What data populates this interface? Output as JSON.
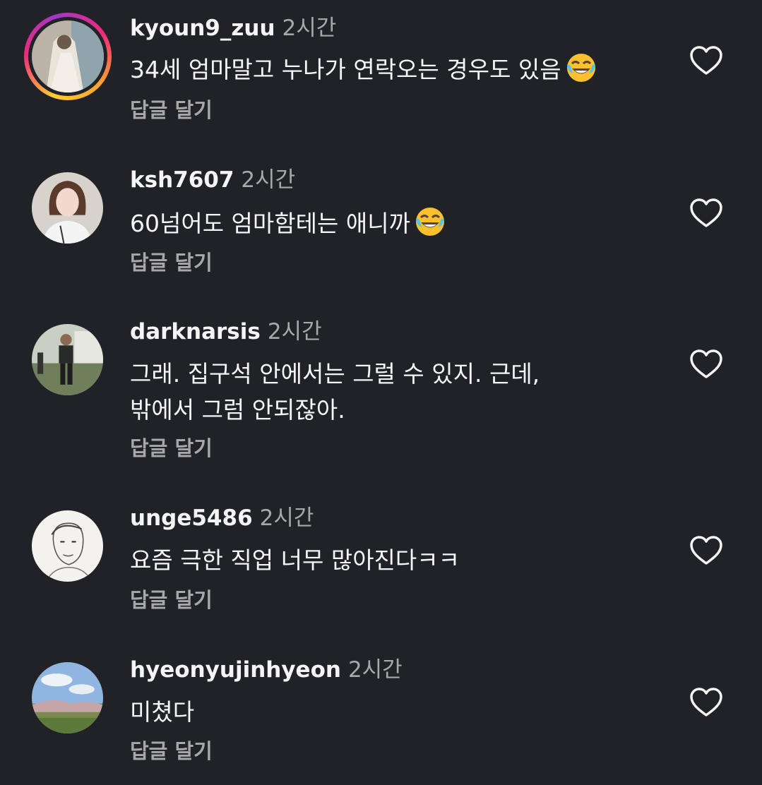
{
  "comments": [
    {
      "username": "kyoun9_zuu",
      "time": "2시간",
      "text_before_emoji": "34세 엄마말고 누나가 연락오는 경우도 있음",
      "text_line2": "",
      "emoji": "face-with-tears-of-joy-icon",
      "reply_label": "답글 달기",
      "has_story_ring": true
    },
    {
      "username": "ksh7607",
      "time": "2시간",
      "text_before_emoji": "60넘어도 엄마함테는 애니까",
      "text_line2": "",
      "emoji": "face-with-tears-of-joy-icon",
      "reply_label": "답글 달기",
      "has_story_ring": false
    },
    {
      "username": "darknarsis",
      "time": "2시간",
      "text_before_emoji": "그래. 집구석 안에서는 그럴 수 있지. 근데,",
      "text_line2": "밖에서 그럼 안되잖아.",
      "emoji": "",
      "reply_label": "답글 달기",
      "has_story_ring": false
    },
    {
      "username": "unge5486",
      "time": "2시간",
      "text_before_emoji": "요즘 극한 직업 너무 많아진다ㅋㅋ",
      "text_line2": "",
      "emoji": "",
      "reply_label": "답글 달기",
      "has_story_ring": false
    },
    {
      "username": "hyeonyujinhyeon",
      "time": "2시간",
      "text_before_emoji": "미쳤다",
      "text_line2": "",
      "emoji": "",
      "reply_label": "답글 달기",
      "has_story_ring": false
    }
  ],
  "colors": {
    "background": "#212228",
    "primary_text": "#f5f5f5",
    "secondary_text": "#a8a8a8",
    "story_ring": [
      "#f9ce34",
      "#ee2a7b",
      "#a336c8"
    ]
  },
  "icons": {
    "like": "heart-outline-icon"
  }
}
